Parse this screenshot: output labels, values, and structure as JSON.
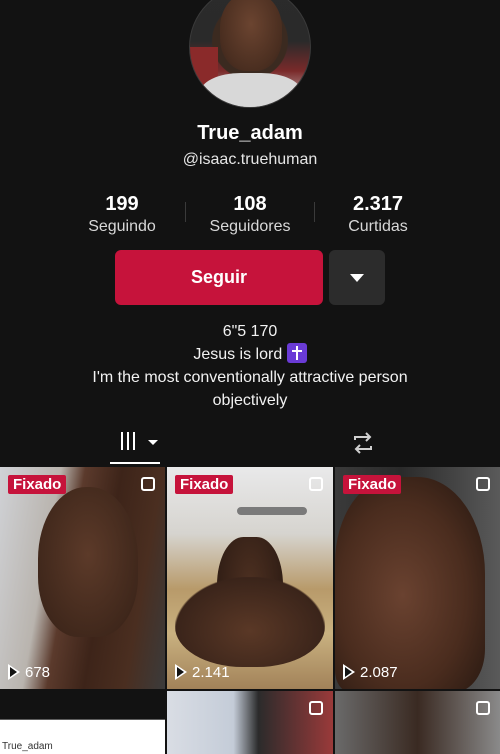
{
  "profile": {
    "display_name": "True_adam",
    "handle": "@isaac.truehuman",
    "stats": [
      {
        "value": "199",
        "label": "Seguindo"
      },
      {
        "value": "108",
        "label": "Seguidores"
      },
      {
        "value": "2.317",
        "label": "Curtidas"
      }
    ],
    "follow_label": "Seguir",
    "bio_lines": [
      "6\"5 170",
      "Jesus is lord",
      "I'm the most conventionally attractive person",
      "objectively"
    ],
    "bio_emoji": "orthodox-cross-icon"
  },
  "tabs": {
    "grid_icon": "grid-bars-icon",
    "repost_icon": "repost-icon"
  },
  "videos": [
    {
      "pinned_label": "Fixado",
      "views": "678"
    },
    {
      "pinned_label": "Fixado",
      "views": "2.141"
    },
    {
      "pinned_label": "Fixado",
      "views": "2.087"
    }
  ],
  "bottom_row": {
    "first_label": "True_adam"
  },
  "colors": {
    "accent": "#c6133b",
    "background": "#121212",
    "secondary_button": "#2c2c2c"
  }
}
